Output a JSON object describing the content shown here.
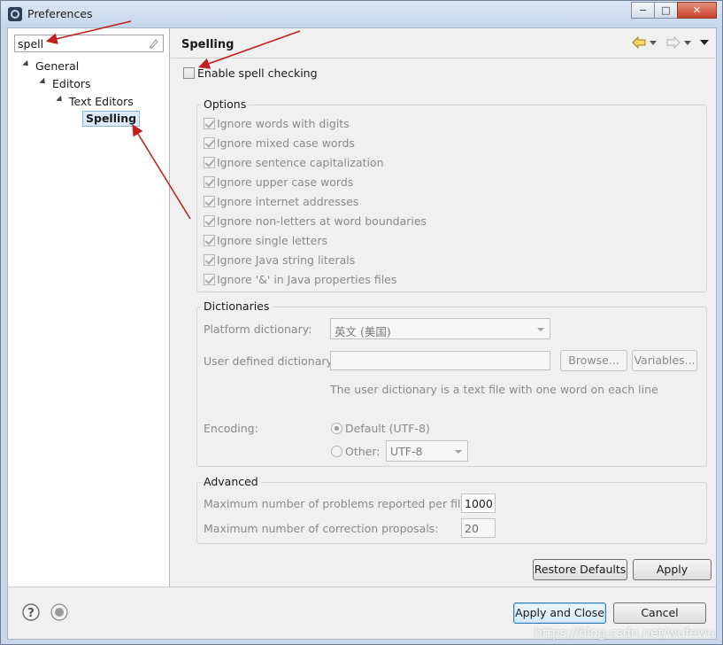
{
  "window": {
    "title": "Preferences",
    "minimize": "−",
    "maximize": "□",
    "close": "✕"
  },
  "filter": {
    "value": "spell"
  },
  "tree": [
    {
      "label": "General"
    },
    {
      "label": "Editors"
    },
    {
      "label": "Text Editors"
    },
    {
      "label": "Spelling"
    }
  ],
  "page": {
    "title": "Spelling"
  },
  "enable": {
    "label": "Enable spell checking",
    "checked": false
  },
  "options": {
    "title": "Options",
    "items": [
      "Ignore words with digits",
      "Ignore mixed case words",
      "Ignore sentence capitalization",
      "Ignore upper case words",
      "Ignore internet addresses",
      "Ignore non-letters at word boundaries",
      "Ignore single letters",
      "Ignore Java string literals",
      "Ignore '&' in Java properties files"
    ]
  },
  "dictionaries": {
    "title": "Dictionaries",
    "platform_label": "Platform dictionary:",
    "platform_value": "英文 (美国)",
    "user_label": "User defined dictionary:",
    "user_value": "",
    "browse": "Browse...",
    "variables": "Variables...",
    "hint": "The user dictionary is a text file with one word on each line",
    "encoding_label": "Encoding:",
    "default_label": "Default (UTF-8)",
    "other_label": "Other:",
    "other_value": "UTF-8"
  },
  "advanced": {
    "title": "Advanced",
    "max_problems_label": "Maximum number of problems reported per file:",
    "max_problems_value": "1000",
    "max_proposals_label": "Maximum number of correction proposals:",
    "max_proposals_value": "20"
  },
  "buttons": {
    "restore": "Restore Defaults",
    "apply": "Apply",
    "apply_close": "Apply and Close",
    "cancel": "Cancel"
  },
  "watermark": "https://blog.csdn.net/wufewu",
  "colors": {
    "annotation": "#c0201c",
    "selection": "#dbeafb",
    "default_button": "#3c7fb1"
  }
}
